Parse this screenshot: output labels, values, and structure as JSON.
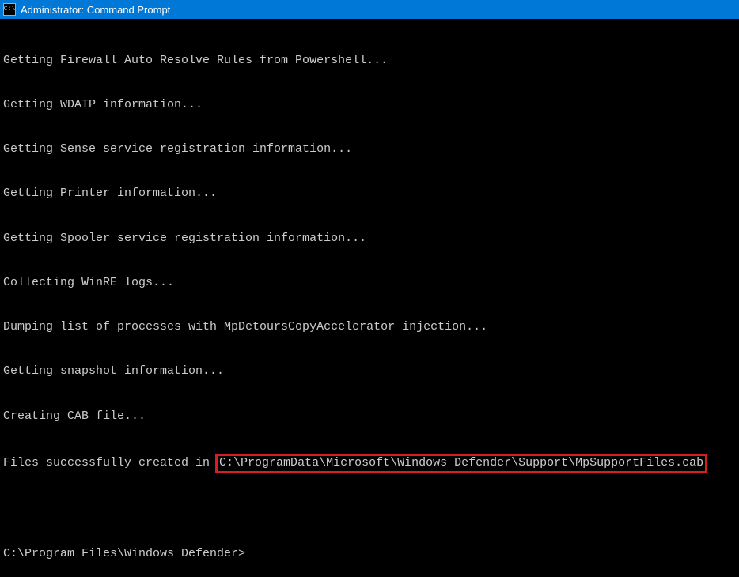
{
  "titlebar": {
    "icon_label": "C:\\",
    "title": "Administrator: Command Prompt"
  },
  "output": {
    "lines": [
      "Getting Firewall Auto Resolve Rules from Powershell...",
      "Getting WDATP information...",
      "Getting Sense service registration information...",
      "Getting Printer information...",
      "Getting Spooler service registration information...",
      "Collecting WinRE logs...",
      "Dumping list of processes with MpDetoursCopyAccelerator injection...",
      "Getting snapshot information...",
      "Creating CAB file..."
    ],
    "success_prefix": "Files successfully created in ",
    "highlighted_path": "C:\\ProgramData\\Microsoft\\Windows Defender\\Support\\MpSupportFiles.cab"
  },
  "prompt": {
    "text": "C:\\Program Files\\Windows Defender>"
  }
}
